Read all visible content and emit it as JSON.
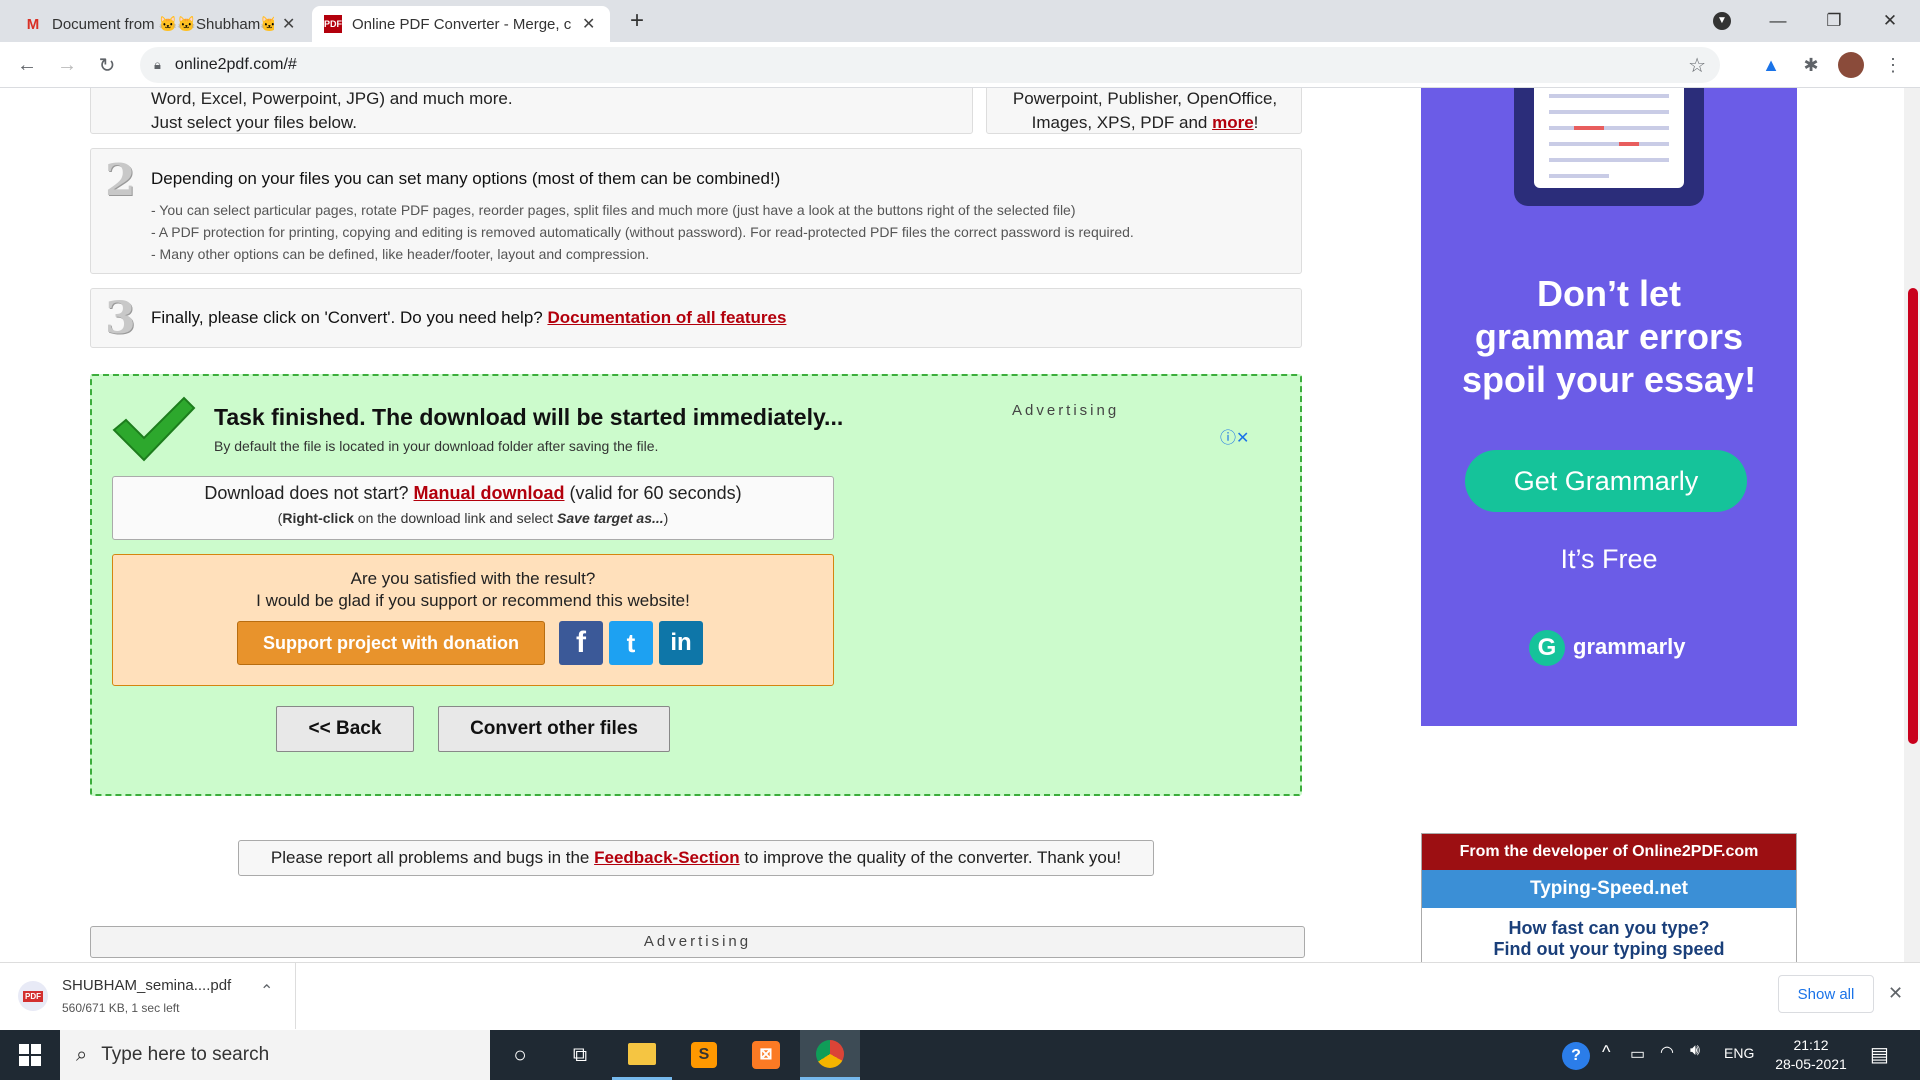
{
  "browser": {
    "tabs": [
      {
        "title": "Document from 🐱🐱Shubham🐱",
        "favicon": "gmail-icon"
      },
      {
        "title": "Online PDF Converter - Merge, c",
        "favicon": "pdf-icon"
      }
    ],
    "url": "online2pdf.com/#"
  },
  "steps": {
    "step1": {
      "line1": "Word, Excel, Powerpoint, JPG) and much more.",
      "line2": "Just select your files below.",
      "right_line1": "Powerpoint, Publisher, OpenOffice,",
      "right_line2": "Images, XPS, PDF and ",
      "more": "more",
      "bang": "!"
    },
    "step2": {
      "number": "2",
      "title": "Depending on your files you can set many options (most of them can be combined!)",
      "bullets": [
        "- You can select particular pages, rotate PDF pages, reorder pages, split files and much more (just have a look at the buttons right of the selected file)",
        "- A PDF protection for printing, copying and editing is removed automatically (without password). For read-protected PDF files the correct password is required.",
        "- Many other options can be defined, like header/footer, layout and compression."
      ]
    },
    "step3": {
      "number": "3",
      "text": "Finally, please click on 'Convert'. Do you need help? ",
      "link": "Documentation of all features"
    }
  },
  "result": {
    "title": "Task finished. The download will be started immediately...",
    "subtitle": "By default the file is located in your download folder after saving the file.",
    "advertising": "Advertising",
    "manual_prefix": "Download does not start? ",
    "manual_link": "Manual download",
    "manual_suffix": " (valid for 60 seconds)",
    "hint_open": "(",
    "hint_bold": "Right-click",
    "hint_mid": " on the download link and select ",
    "hint_italic": "Save target as...",
    "hint_close": ")",
    "satisfied": "Are you satisfied with the result?",
    "support_text": "I would be glad if you support or recommend this website!",
    "donate": "Support project with donation",
    "social": [
      "f",
      "t",
      "in"
    ],
    "back": "<< Back",
    "convert_other": "Convert other files"
  },
  "feedback": {
    "prefix": "Please report all problems and bugs in the ",
    "link": "Feedback-Section",
    "suffix": " to improve the quality of the converter. Thank you!"
  },
  "ad_label": "Advertising",
  "side_ad": {
    "headline": [
      "Don’t let",
      "grammar errors",
      "spoil your essay!"
    ],
    "cta": "Get Grammarly",
    "free": "It’s Free",
    "brand": "grammarly"
  },
  "dev_box": {
    "header": "From the developer of Online2PDF.com",
    "title": "Typing-Speed.net",
    "line1": "How fast can you type?",
    "line2": "Find out your typing speed"
  },
  "download": {
    "file": "SHUBHAM_semina....pdf",
    "status": "560/671 KB, 1 sec left",
    "show_all": "Show all"
  },
  "taskbar": {
    "search": "Type here to search",
    "lang": "ENG",
    "time": "21:12",
    "date": "28-05-2021"
  },
  "colors": {
    "accent_red": "#b3000c",
    "success_green": "#ccfbcc",
    "ad_purple": "#6b5ce7",
    "grammarly_green": "#15c39a",
    "donate_orange": "#e8932c"
  }
}
